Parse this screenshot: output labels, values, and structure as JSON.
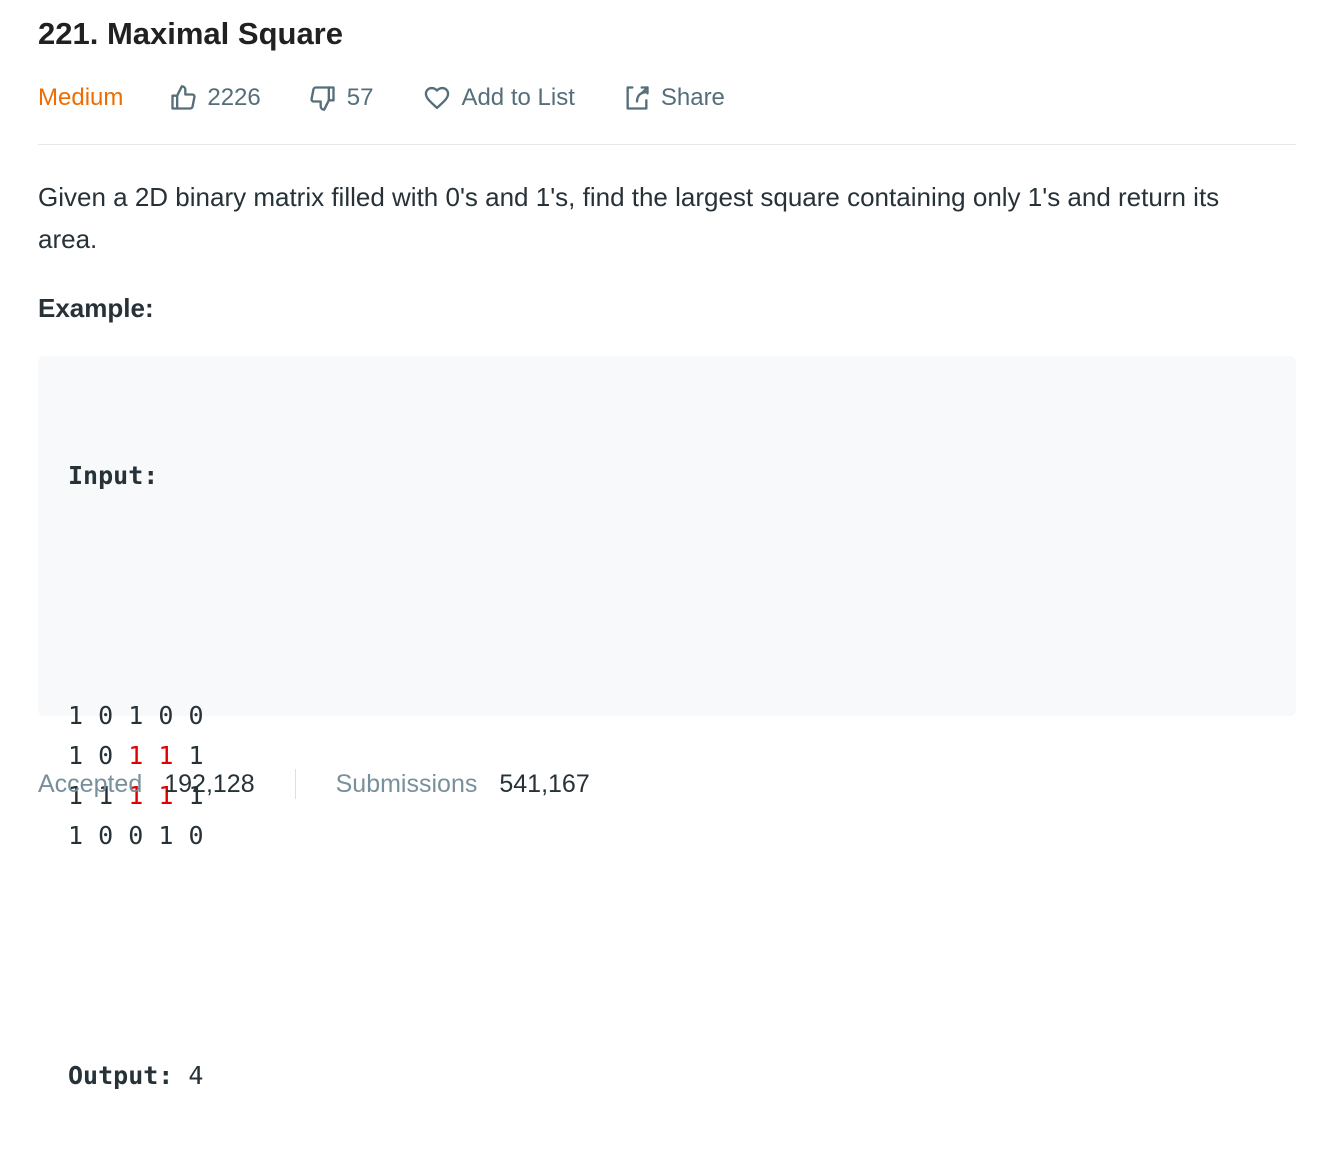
{
  "problem": {
    "title": "221. Maximal Square",
    "difficulty": "Medium",
    "likes": "2226",
    "dislikes": "57",
    "add_to_list_label": "Add to List",
    "share_label": "Share",
    "description": "Given a 2D binary matrix filled with 0's and 1's, find the largest square containing only 1's and return its area.",
    "example_heading": "Example:",
    "example": {
      "input_label": "Input:",
      "matrix": [
        [
          "1",
          "0",
          "1",
          "0",
          "0"
        ],
        [
          "1",
          "0",
          "1",
          "1",
          "1"
        ],
        [
          "1",
          "1",
          "1",
          "1",
          "1"
        ],
        [
          "1",
          "0",
          "0",
          "1",
          "0"
        ]
      ],
      "highlighted": [
        [
          1,
          2
        ],
        [
          1,
          3
        ],
        [
          2,
          2
        ],
        [
          2,
          3
        ]
      ],
      "output_label": "Output:",
      "output_value": "4"
    }
  },
  "stats": {
    "accepted_label": "Accepted",
    "accepted_value": "192,128",
    "submissions_label": "Submissions",
    "submissions_value": "541,167"
  },
  "colors": {
    "difficulty_medium": "#ef6c00",
    "highlight": "#e00000",
    "code_background": "#f7f9fa"
  },
  "icons": {
    "like": "thumbs-up-icon",
    "dislike": "thumbs-down-icon",
    "add_to_list": "heart-icon",
    "share": "share-icon"
  }
}
